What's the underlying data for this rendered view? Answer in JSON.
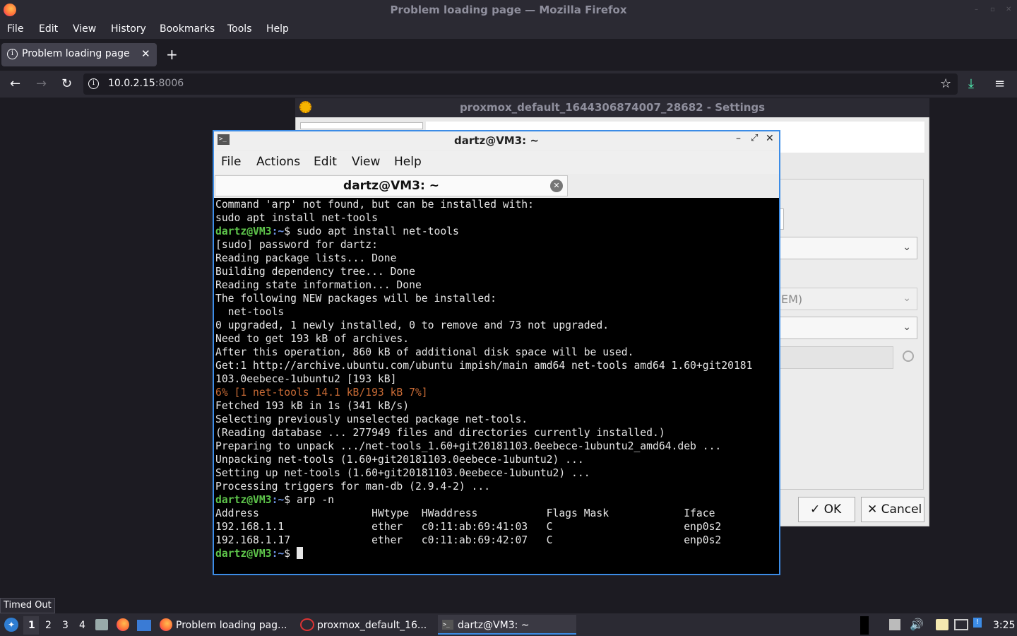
{
  "browser": {
    "window_title": "Problem loading page — Mozilla Firefox",
    "menu": [
      "File",
      "Edit",
      "View",
      "History",
      "Bookmarks",
      "Tools",
      "Help"
    ],
    "tab_title": "Problem loading page",
    "url_host": "10.0.2.15",
    "url_port": ":8006",
    "status_text": "Timed Out"
  },
  "settings_window": {
    "title": "proxmox_default_1644306874007_28682 - Settings",
    "partial_select_text": "EM)",
    "ok_label": "OK",
    "cancel_label": "Cancel"
  },
  "terminal": {
    "title": "dartz@VM3: ~",
    "menu": [
      "File",
      "Actions",
      "Edit",
      "View",
      "Help"
    ],
    "tab_label": "dartz@VM3: ~",
    "prompt_user": "dartz@VM3",
    "prompt_path": ":~",
    "lines": [
      "Command 'arp' not found, but can be installed with:",
      "sudo apt install net-tools"
    ],
    "cmd1": "$ sudo apt install net-tools",
    "output1": [
      "[sudo] password for dartz:",
      "Reading package lists... Done",
      "Building dependency tree... Done",
      "Reading state information... Done",
      "The following NEW packages will be installed:",
      "  net-tools",
      "0 upgraded, 1 newly installed, 0 to remove and 73 not upgraded.",
      "Need to get 193 kB of archives.",
      "After this operation, 860 kB of additional disk space will be used.",
      "Get:1 http://archive.ubuntu.com/ubuntu impish/main amd64 net-tools amd64 1.60+git20181",
      "103.0eebece-1ubuntu2 [193 kB]"
    ],
    "progress_line": "6% [1 net-tools 14.1 kB/193 kB 7%]",
    "output2": [
      "Fetched 193 kB in 1s (341 kB/s)",
      "Selecting previously unselected package net-tools.",
      "(Reading database ... 277949 files and directories currently installed.)",
      "Preparing to unpack .../net-tools_1.60+git20181103.0eebece-1ubuntu2_amd64.deb ...",
      "Unpacking net-tools (1.60+git20181103.0eebece-1ubuntu2) ...",
      "Setting up net-tools (1.60+git20181103.0eebece-1ubuntu2) ...",
      "Processing triggers for man-db (2.9.4-2) ..."
    ],
    "cmd2": "$ arp -n",
    "arp_table": [
      "Address                  HWtype  HWaddress           Flags Mask            Iface",
      "192.168.1.1              ether   c0:11:ab:69:41:03   C                     enp0s2",
      "192.168.1.17             ether   c0:11:ab:69:42:07   C                     enp0s2"
    ],
    "cmd3": "$ "
  },
  "taskbar": {
    "workspaces": [
      "1",
      "2",
      "3",
      "4"
    ],
    "tasks": [
      "Problem loading pag...",
      "proxmox_default_16...",
      "dartz@VM3: ~"
    ],
    "clock": "3:25"
  }
}
